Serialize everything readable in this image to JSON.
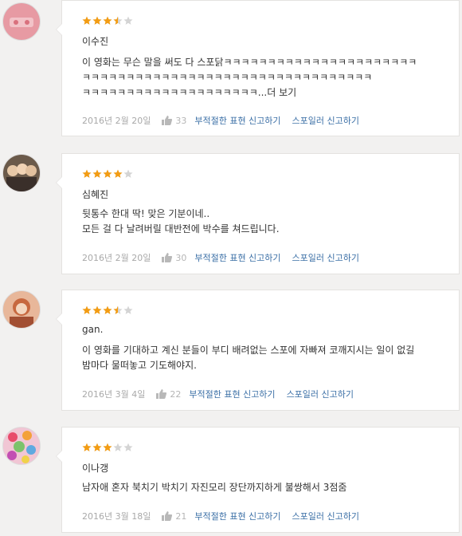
{
  "colors": {
    "star_on": "#f39c12",
    "star_off": "#d4d4d4",
    "link": "#3b6fa6",
    "meta": "#a9a9a9"
  },
  "reviews": [
    {
      "name": "이수진",
      "rating": 3.5,
      "text": "이 영화는 무슨 말을 써도 다 스포닭ㅋㅋㅋㅋㅋㅋㅋㅋㅋㅋㅋㅋㅋㅋㅋㅋㅋㅋㅋㅋㅋㅋ\nㅋㅋㅋㅋㅋㅋㅋㅋㅋㅋㅋㅋㅋㅋㅋㅋㅋㅋㅋㅋㅋㅋㅋㅋㅋㅋㅋㅋㅋㅋㅋㅋㅋ\nㅋㅋㅋㅋㅋㅋㅋㅋㅋㅋㅋㅋㅋㅋㅋㅋㅋㅋㅋㅋ...",
      "more": "더 보기",
      "date": "2016년 2월 20일",
      "likes": "33",
      "report_expression": "부적절한 표현 신고하기",
      "report_spoiler": "스포일러 신고하기",
      "avatar_icon": "pink-avatar"
    },
    {
      "name": "심혜진",
      "rating": 4,
      "text": "뒷통수 한대 딱! 맞은 기분이네..\n모든 걸 다 날려버릴 대반전에 박수를 쳐드립니다.",
      "more": "",
      "date": "2016년 2월 20일",
      "likes": "30",
      "report_expression": "부적절한 표현 신고하기",
      "report_spoiler": "스포일러 신고하기",
      "avatar_icon": "group-photo-avatar"
    },
    {
      "name": "gan.",
      "rating": 3.5,
      "text": "이 영화를 기대하고 계신 분들이 부디 배려없는 스포에 자빠져 코깨지시는 일이 없길\n밤마다 물떠놓고 기도해야지.",
      "more": "",
      "date": "2016년 3월 4일",
      "likes": "22",
      "report_expression": "부적절한 표현 신고하기",
      "report_spoiler": "스포일러 신고하기",
      "avatar_icon": "illustration-avatar"
    },
    {
      "name": "이나갱",
      "rating": 3,
      "text": "남자애 혼자 북치기 박치기 자진모리 장단까지하게 불쌍해서 3점줌",
      "more": "",
      "date": "2016년 3월 18일",
      "likes": "21",
      "report_expression": "부적절한 표현 신고하기",
      "report_spoiler": "스포일러 신고하기",
      "avatar_icon": "candy-avatar"
    }
  ]
}
